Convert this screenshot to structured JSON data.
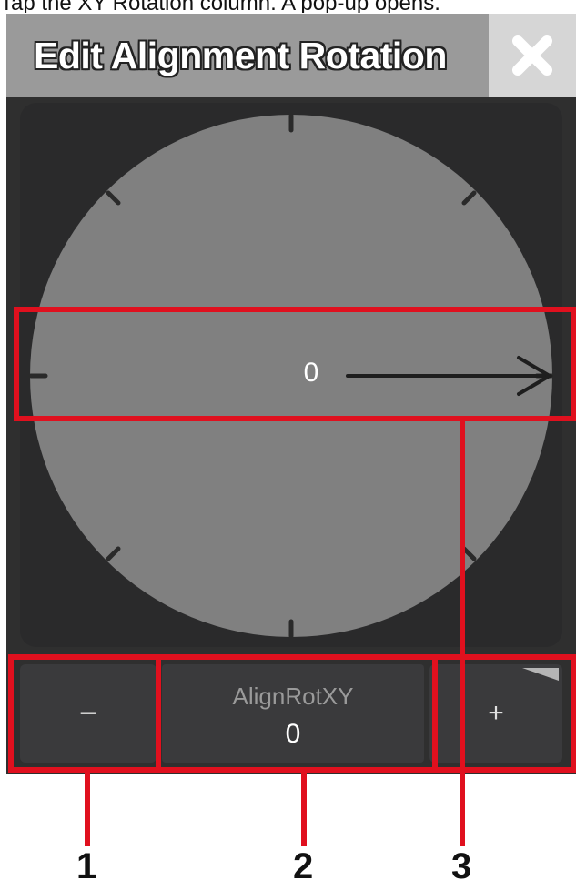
{
  "caption": "Tap the XY Rotation column. A pop-up opens.",
  "dialog": {
    "title": "Edit Alignment Rotation",
    "close_icon": "close-icon"
  },
  "dial": {
    "value": "0",
    "rotation_degrees": 0
  },
  "controls": {
    "minus_label": "−",
    "field_label": "AlignRotXY",
    "field_value": "0",
    "plus_label": "+"
  },
  "callouts": [
    "1",
    "2",
    "3"
  ],
  "colors": {
    "highlight": "#e0101e",
    "dial_fill": "#808080",
    "panel": "#2a2a2b"
  }
}
